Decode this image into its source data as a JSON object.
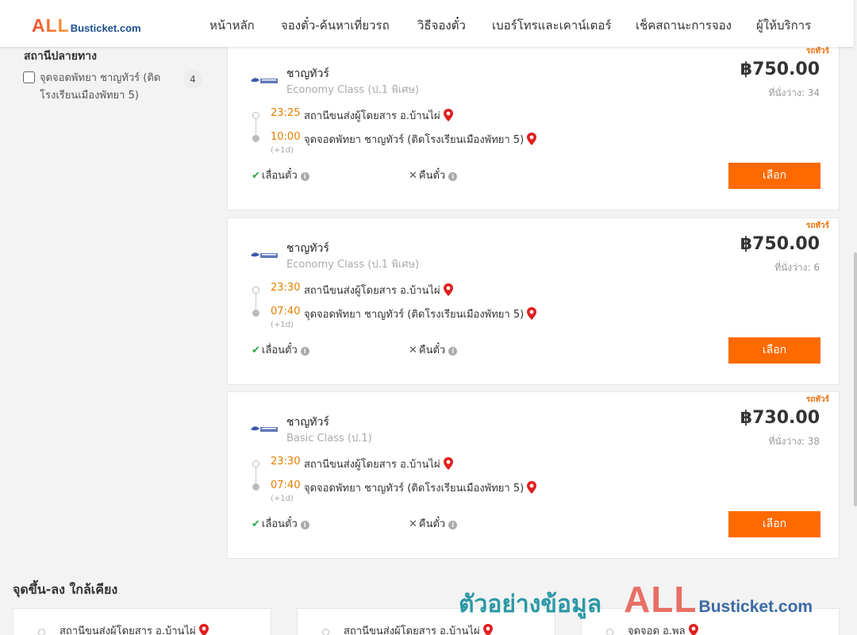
{
  "header": {
    "logo_main": "ALL",
    "logo_sub": "Busticket.com",
    "nav": [
      "หน้าหลัก",
      "จองตั๋ว-ค้นหาเที่ยวรถ",
      "วิธีจองตั๋ว",
      "เบอร์โทรและเคาน์เตอร์",
      "เช็คสถานะการจอง",
      "ผู้ให้บริการ"
    ]
  },
  "sidebar": {
    "section_title": "สถานีปลายทาง",
    "filters": [
      {
        "label": "จุดจอดพัทยา ชาญทัวร์ (ติดโรงเรียนเมืองพัทยา 5)",
        "count": "4",
        "checked": false
      }
    ]
  },
  "trips": [
    {
      "tag": "รถทัวร์",
      "operator": "ชาญทัวร์",
      "bus_class": "Economy Class (ป.1 พิเศษ)",
      "price": "฿750.00",
      "seats": "ที่นั่งว่าง: 34",
      "depart_time": "23:25",
      "depart_place": "สถานีขนส่งผู้โดยสาร อ.บ้านไผ่",
      "arrive_time": "10:00",
      "arrive_place": "จุดจอดพัทยา ชาญทัวร์ (ติดโรงเรียนเมืองพัทยา 5)",
      "next_day": "(+1d)",
      "feature_1": "เลื่อนตั๋ว",
      "feature_2": "คืนตั๋ว",
      "button": "เลือก"
    },
    {
      "tag": "รถทัวร์",
      "operator": "ชาญทัวร์",
      "bus_class": "Economy Class (ป.1 พิเศษ)",
      "price": "฿750.00",
      "seats": "ที่นั่งว่าง: 6",
      "depart_time": "23:30",
      "depart_place": "สถานีขนส่งผู้โดยสาร อ.บ้านไผ่",
      "arrive_time": "07:40",
      "arrive_place": "จุดจอดพัทยา ชาญทัวร์ (ติดโรงเรียนเมืองพัทยา 5)",
      "next_day": "(+1d)",
      "feature_1": "เลื่อนตั๋ว",
      "feature_2": "คืนตั๋ว",
      "button": "เลือก"
    },
    {
      "tag": "รถทัวร์",
      "operator": "ชาญทัวร์",
      "bus_class": "Basic Class (ป.1)",
      "price": "฿730.00",
      "seats": "ที่นั่งว่าง: 38",
      "depart_time": "23:30",
      "depart_place": "สถานีขนส่งผู้โดยสาร อ.บ้านไผ่",
      "arrive_time": "07:40",
      "arrive_place": "จุดจอดพัทยา ชาญทัวร์ (ติดโรงเรียนเมืองพัทยา 5)",
      "next_day": "(+1d)",
      "feature_1": "เลื่อนตั๋ว",
      "feature_2": "คืนตั๋ว",
      "button": "เลือก"
    }
  ],
  "nearby": {
    "title": "จุดขึ้น-ลง ใกล้เคียง",
    "stops": [
      "สถานีขนส่งผู้โดยสาร อ.บ้านไผ่",
      "สถานีขนส่งผู้โดยสาร อ.บ้านไผ่",
      "จุดจอด อ.พล"
    ]
  },
  "watermark": {
    "text": "ตัวอย่างข้อมูล",
    "brand_main": "ALL",
    "brand_sub": "Busticket.com"
  },
  "colors": {
    "accent": "#ff6a00",
    "time": "#e67e00",
    "check": "#2ca84a",
    "pin": "#e02020"
  }
}
